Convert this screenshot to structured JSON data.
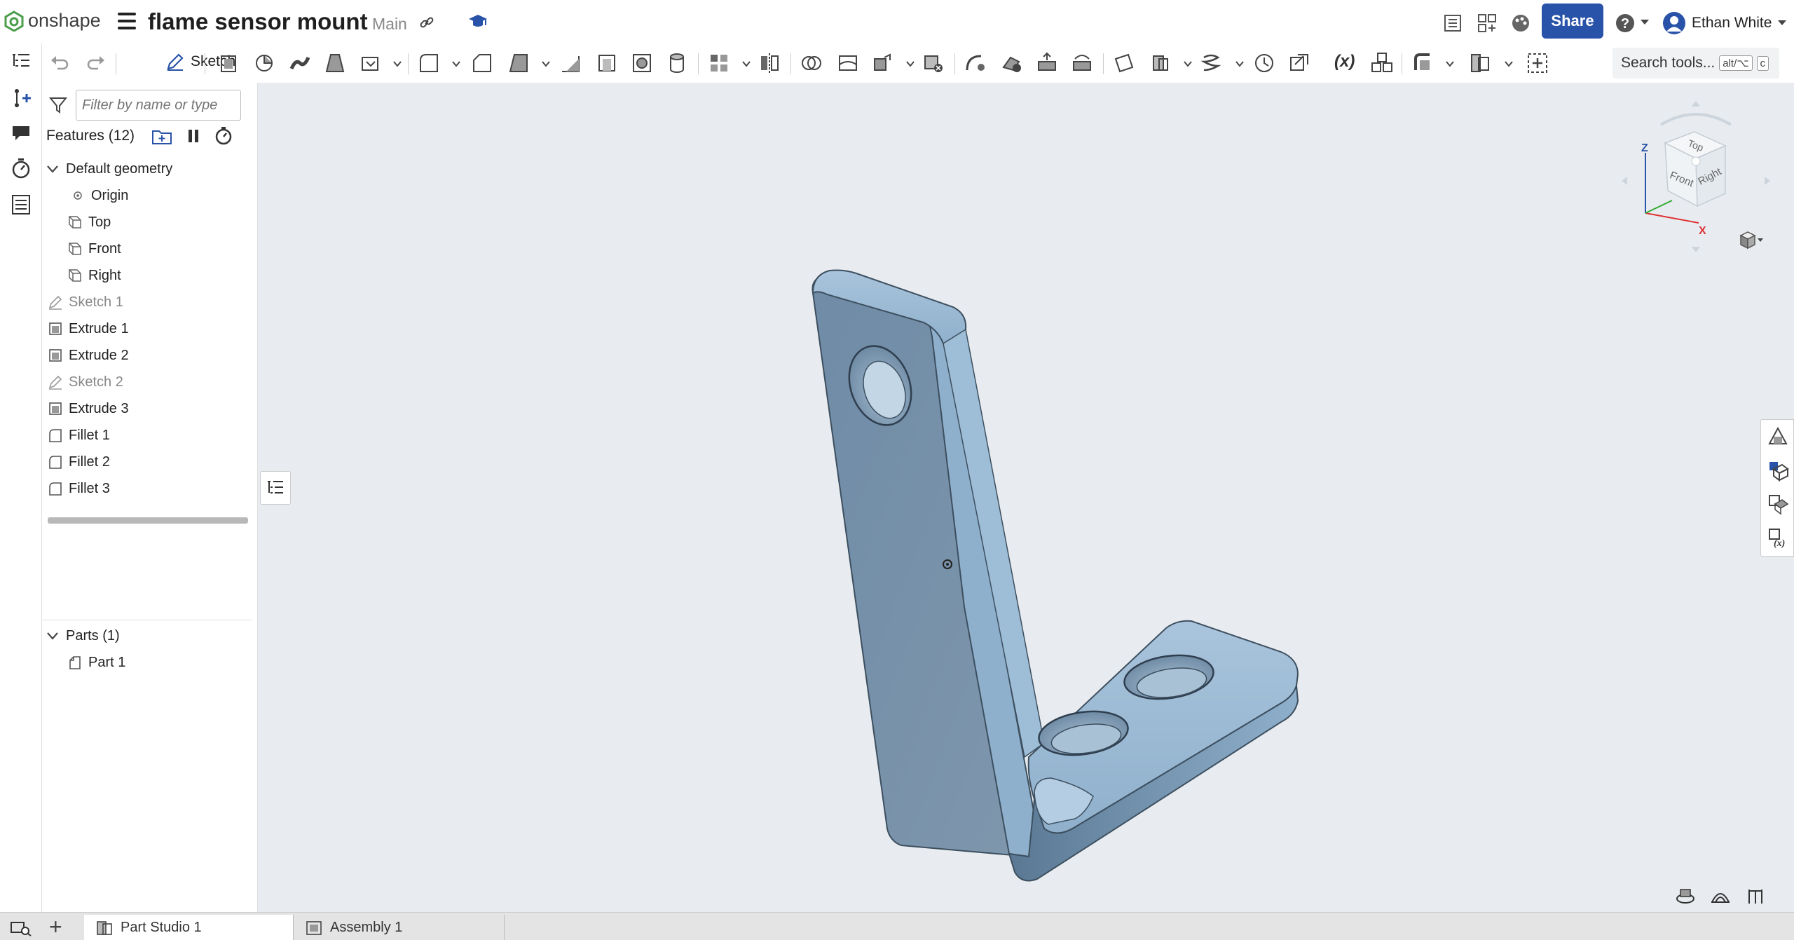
{
  "app": {
    "brand": "onshape"
  },
  "document": {
    "title": "flame sensor mount",
    "branch": "Main"
  },
  "header": {
    "share_label": "Share",
    "user_name": "Ethan White"
  },
  "toolbar": {
    "sketch_label": "Sketch",
    "search_label": "Search tools...",
    "search_shortcut_1": "alt/⌥",
    "search_shortcut_2": "c"
  },
  "panel": {
    "filter_placeholder": "Filter by name or type",
    "features_header": "Features (12)",
    "default_geometry": "Default geometry",
    "geometry_items": [
      "Origin",
      "Top",
      "Front",
      "Right"
    ],
    "features": [
      {
        "label": "Sketch 1",
        "type": "sketch"
      },
      {
        "label": "Extrude 1",
        "type": "extrude"
      },
      {
        "label": "Extrude 2",
        "type": "extrude"
      },
      {
        "label": "Sketch 2",
        "type": "sketch"
      },
      {
        "label": "Extrude 3",
        "type": "extrude"
      },
      {
        "label": "Fillet 1",
        "type": "fillet"
      },
      {
        "label": "Fillet 2",
        "type": "fillet"
      },
      {
        "label": "Fillet 3",
        "type": "fillet"
      }
    ],
    "parts_header": "Parts (1)",
    "parts": [
      "Part 1"
    ]
  },
  "viewcube": {
    "top": "Top",
    "front": "Front",
    "right": "Right",
    "axis_x": "X",
    "axis_z": "Z"
  },
  "tabs": [
    {
      "label": "Part Studio 1",
      "active": true
    },
    {
      "label": "Assembly 1",
      "active": false
    }
  ],
  "colors": {
    "accent": "#2953a8",
    "viewport_bg": "#e8ecf0",
    "part_fill": "#8fa7bd"
  }
}
